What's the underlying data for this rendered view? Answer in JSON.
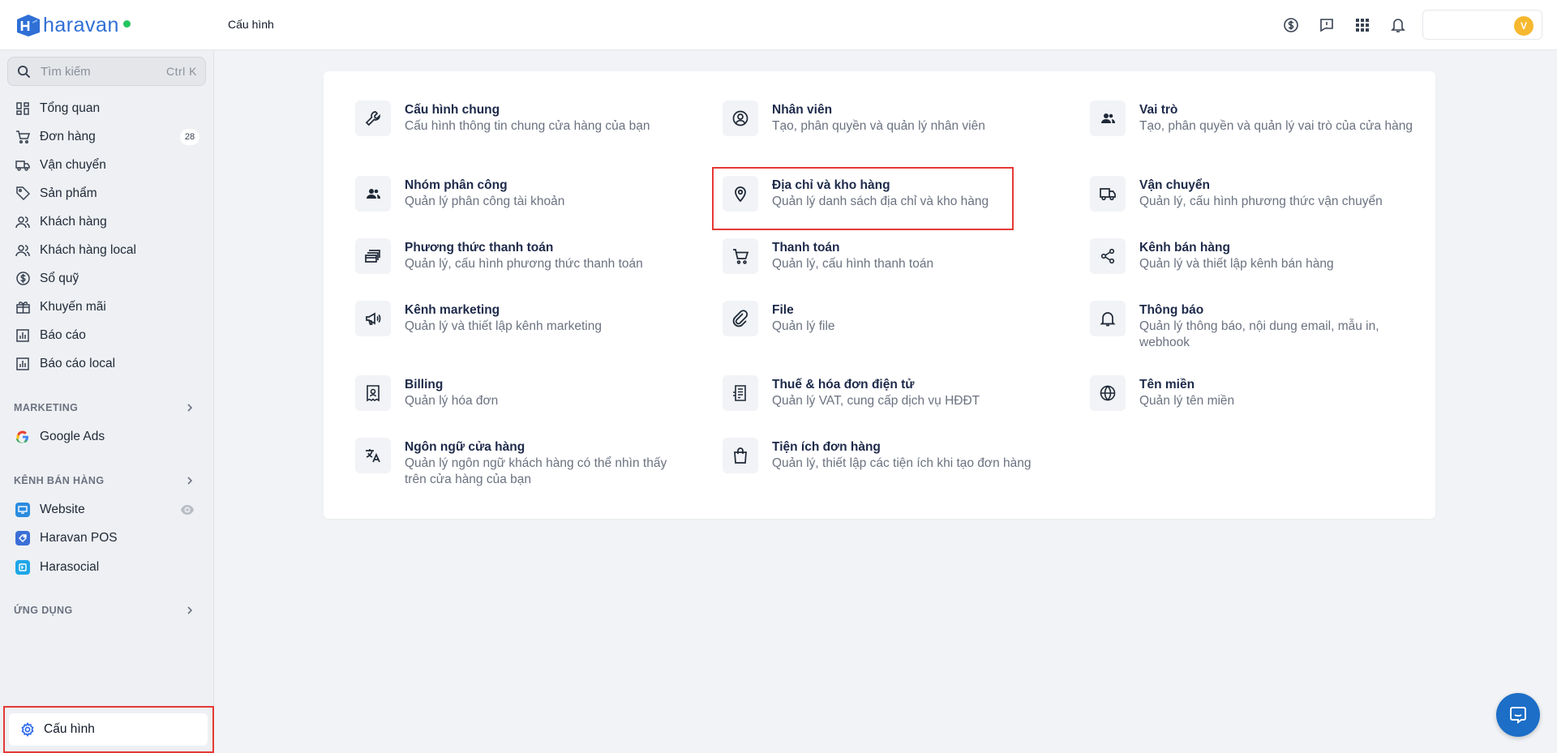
{
  "header": {
    "brand": "haravan",
    "page_title": "Cấu hình",
    "avatar_initial": "V",
    "brand_color": "#2f6fd6",
    "status_color": "#22c55e"
  },
  "sidebar": {
    "search": {
      "placeholder": "Tìm kiếm",
      "shortcut": "Ctrl K"
    },
    "items": [
      {
        "label": "Tổng quan",
        "icon": "dashboard-icon"
      },
      {
        "label": "Đơn hàng",
        "icon": "cart-icon",
        "badge": "28"
      },
      {
        "label": "Vận chuyển",
        "icon": "truck-icon"
      },
      {
        "label": "Sản phẩm",
        "icon": "tag-icon"
      },
      {
        "label": "Khách hàng",
        "icon": "users-icon"
      },
      {
        "label": "Khách hàng local",
        "icon": "users-icon"
      },
      {
        "label": "Sổ quỹ",
        "icon": "dollar-icon"
      },
      {
        "label": "Khuyến mãi",
        "icon": "gift-icon"
      },
      {
        "label": "Báo cáo",
        "icon": "bar-chart-icon"
      },
      {
        "label": "Báo cáo local",
        "icon": "bar-chart-icon"
      }
    ],
    "marketing": {
      "title": "MARKETING",
      "items": [
        {
          "label": "Google Ads"
        }
      ]
    },
    "channels": {
      "title": "KÊNH BÁN HÀNG",
      "items": [
        {
          "label": "Website"
        },
        {
          "label": "Haravan POS"
        },
        {
          "label": "Harasocial"
        }
      ]
    },
    "apps": {
      "title": "ỨNG DỤNG"
    },
    "settings": {
      "label": "Cấu hình"
    }
  },
  "settings_tiles": [
    {
      "title": "Cấu hình chung",
      "desc": "Cấu hình thông tin chung cửa hàng của bạn",
      "icon": "wrench-icon"
    },
    {
      "title": "Nhân viên",
      "desc": "Tạo, phân quyền và quản lý nhân viên",
      "icon": "user-circle-icon"
    },
    {
      "title": "Vai trò",
      "desc": "Tạo, phân quyền và quản lý vai trò của cửa hàng",
      "icon": "users-icon"
    },
    {
      "title": "Nhóm phân công",
      "desc": "Quản lý phân công tài khoản",
      "icon": "users-icon"
    },
    {
      "title": "Địa chỉ và kho hàng",
      "desc": "Quản lý danh sách địa chỉ và kho hàng",
      "icon": "map-pin-icon"
    },
    {
      "title": "Vận chuyển",
      "desc": "Quản lý, cấu hình phương thức vận chuyển",
      "icon": "truck-icon"
    },
    {
      "title": "Phương thức thanh toán",
      "desc": "Quản lý, cấu hình phương thức thanh toán",
      "icon": "credit-card-icon"
    },
    {
      "title": "Thanh toán",
      "desc": "Quản lý, cấu hình thanh toán",
      "icon": "cart-icon"
    },
    {
      "title": "Kênh bán hàng",
      "desc": "Quản lý và thiết lập kênh bán hàng",
      "icon": "share-icon"
    },
    {
      "title": "Kênh marketing",
      "desc": "Quản lý và thiết lập kênh marketing",
      "icon": "megaphone-icon"
    },
    {
      "title": "File",
      "desc": "Quản lý file",
      "icon": "paperclip-icon"
    },
    {
      "title": "Thông báo",
      "desc": "Quản lý thông báo, nội dung email, mẫu in, webhook",
      "icon": "bell-icon"
    },
    {
      "title": "Billing",
      "desc": "Quản lý hóa đơn",
      "icon": "receipt-icon"
    },
    {
      "title": "Thuế & hóa đơn điện tử",
      "desc": "Quản lý VAT, cung cấp dịch vụ HĐĐT",
      "icon": "invoice-icon"
    },
    {
      "title": "Tên miền",
      "desc": "Quản lý tên miền",
      "icon": "globe-icon"
    },
    {
      "title": "Ngôn ngữ cửa hàng",
      "desc": "Quản lý ngôn ngữ khách hàng có thể nhìn thấy trên cửa hàng của bạn",
      "icon": "translate-icon"
    },
    {
      "title": "Tiện ích đơn hàng",
      "desc": "Quản lý, thiết lập các tiện ích khi tạo đơn hàng",
      "icon": "shopping-bag-icon"
    }
  ]
}
